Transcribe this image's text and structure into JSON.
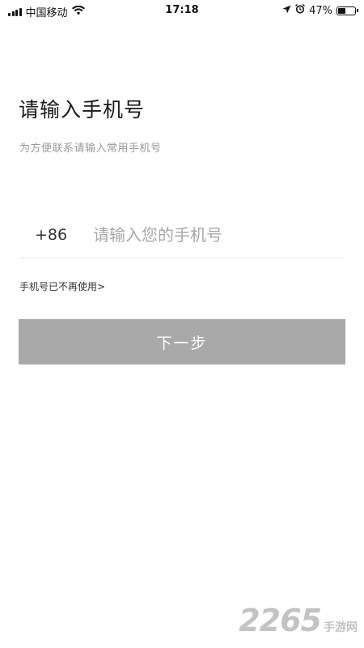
{
  "status_bar": {
    "carrier": "中国移动",
    "time": "17:18",
    "battery_percent": "47%",
    "battery_level": 0.47,
    "icons": [
      "signal-icon",
      "wifi-icon",
      "location-icon",
      "alarm-icon",
      "battery-icon"
    ]
  },
  "page": {
    "title": "请输入手机号",
    "subtitle": "为方便联系请输入常用手机号"
  },
  "phone": {
    "country_code": "+86",
    "value": "",
    "placeholder": "请输入您的手机号"
  },
  "links": {
    "no_longer_used": "手机号已不再使用>"
  },
  "actions": {
    "next_label": "下一步"
  },
  "watermark": {
    "number": "2265",
    "text": "手游网"
  },
  "colors": {
    "button_disabled": "#a9a9a9",
    "subtitle_gray": "#9a9a9a",
    "divider": "#e6e6e6"
  }
}
